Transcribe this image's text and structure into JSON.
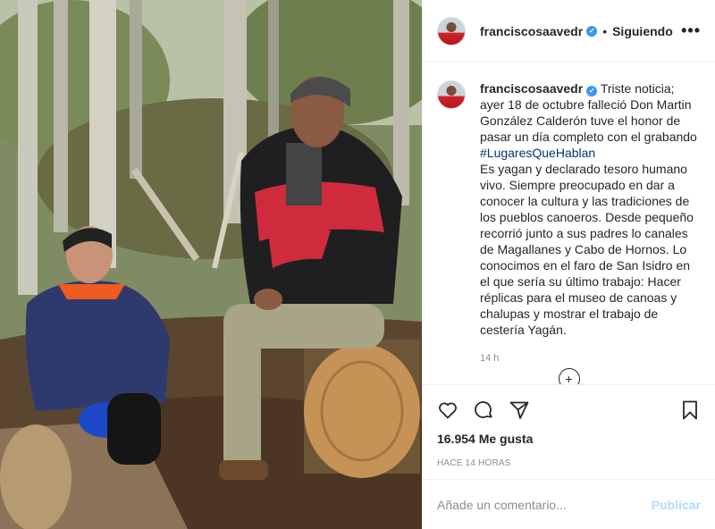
{
  "header": {
    "username": "franciscosaavedr",
    "verified_mark": "✓",
    "separator": "•",
    "follow_status": "Siguiendo",
    "more_icon": "more-horizontal-icon",
    "more_glyph": "•••"
  },
  "caption": {
    "username": "franciscosaavedr",
    "text_before_tag": "Triste noticia; ayer 18 de octubre falleció Don Martin González Calderón tuve el honor de pasar un día completo con el grabando ",
    "hashtag": "#LugaresQueHablan",
    "text_after_tag": "Es yagan y declarado tesoro humano vivo. Siempre preocupado en dar a conocer la cultura y las tradiciones de los pueblos canoeros. Desde pequeño recorrió junto a sus padres lo canales de Magallanes y Cabo de Hornos. Lo conocimos en el faro de San Isidro en el que sería su último trabajo: Hacer réplicas para el museo de canoas y chalupas y mostrar el trabajo de cestería Yagán.",
    "time": "14 h"
  },
  "actions": {
    "like_icon": "heart-icon",
    "comment_icon": "comment-icon",
    "share_icon": "paper-plane-icon",
    "save_icon": "bookmark-icon",
    "likes_text": "16.954 Me gusta",
    "posted_ago": "HACE 14 HORAS"
  },
  "comment_box": {
    "placeholder": "Añade un comentario...",
    "publish_label": "Publicar"
  },
  "colors": {
    "link": "#00376b",
    "verified": "#3897f0",
    "publish_disabled": "#b3dbff",
    "muted": "#8e8e8e"
  }
}
